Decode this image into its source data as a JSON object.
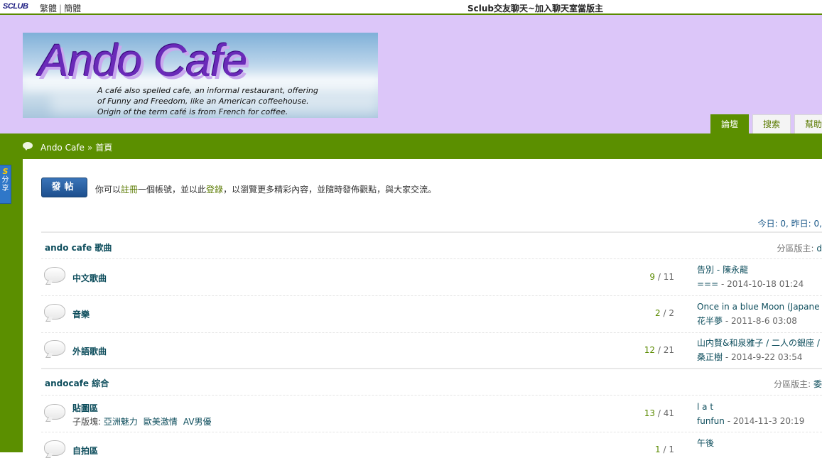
{
  "topbar": {
    "logo": "SCLUB",
    "lang_trad": "繁體",
    "lang_sep": "|",
    "lang_simp": "簡體",
    "promo": "Sclub交友聊天~加入聊天室當版主"
  },
  "header": {
    "banner_title": "Ando Cafe",
    "tagline": [
      "A café also spelled cafe, an informal restaurant, offering",
      "of Funny and Freedom, like an American coffeehouse.",
      "Origin of the term café is from French for coffee."
    ],
    "tabs": [
      {
        "label": "論壇",
        "active": true
      },
      {
        "label": "搜索",
        "active": false
      },
      {
        "label": "幫助",
        "active": false
      }
    ]
  },
  "breadcrumb": {
    "home": "Ando Cafe",
    "sep": "»",
    "current": "首頁"
  },
  "share": {
    "icon_letter": "S",
    "label_1": "分",
    "label_2": "享"
  },
  "toolbar": {
    "post_label": "發帖",
    "notice_pre": "你可以",
    "register_link": "註冊",
    "notice_mid": "一個帳號，並以此",
    "login_link": "登錄",
    "notice_post": "，以瀏覽更多精彩內容，並隨時發佈觀點，與大家交流。"
  },
  "stats": "今日: 0, 昨日: 0,",
  "categories": [
    {
      "title": "ando cafe 歌曲",
      "moderator_label": "分區版主:",
      "moderator_value": "d",
      "forums": [
        {
          "name": "中文歌曲",
          "topics": "9",
          "posts": "11",
          "last_title": "告別 - 陳永龍",
          "last_user": "===",
          "last_date": "2014-10-18 01:24"
        },
        {
          "name": "音樂",
          "topics": "2",
          "posts": "2",
          "last_title": "Once in a blue Moon (Japane",
          "last_user": "花半夢",
          "last_date": "2011-8-6 03:08"
        },
        {
          "name": "外語歌曲",
          "topics": "12",
          "posts": "21",
          "last_title": "山内賢&和泉雅子 / 二人の銀座 /",
          "last_user": "桑正樹",
          "last_date": "2014-9-22 03:54"
        }
      ]
    },
    {
      "title": "andocafe 綜合",
      "moderator_label": "分區版主:",
      "moderator_value": "委",
      "forums": [
        {
          "name": "貼圖區",
          "subforum_label": "子版塊:",
          "subforums": [
            "亞洲魅力",
            "歐美激情",
            "AV男優"
          ],
          "topics": "13",
          "posts": "41",
          "last_title": "l a t",
          "last_user": "funfun",
          "last_date": "2014-11-3 20:19"
        },
        {
          "name": "自拍區",
          "topics": "1",
          "posts": "1",
          "last_title": "午後",
          "last_user": "",
          "last_date": ""
        }
      ]
    }
  ],
  "colors": {
    "green": "#5b8f00",
    "lavender": "#dcc6f9",
    "link": "#0d4d5c"
  }
}
